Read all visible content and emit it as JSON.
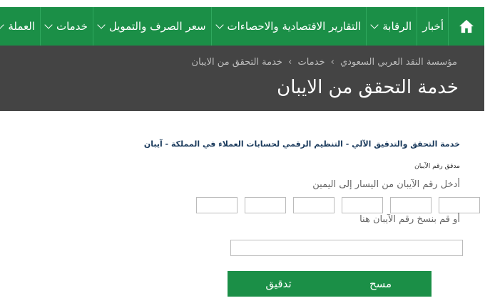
{
  "nav": {
    "items": [
      {
        "label": "أخبار",
        "has_dropdown": false
      },
      {
        "label": "الرقابة",
        "has_dropdown": true
      },
      {
        "label": "التقارير الاقتصادية والاحصاءات",
        "has_dropdown": true
      },
      {
        "label": "سعر الصرف والتمويل",
        "has_dropdown": true
      },
      {
        "label": "خدمات",
        "has_dropdown": true
      },
      {
        "label": "العملة",
        "has_dropdown": true
      }
    ],
    "home_icon": "home-icon",
    "accent_color": "#1b8f47"
  },
  "banner": {
    "breadcrumb": [
      "مؤسسة النقد العربي السعودي",
      "خدمات",
      "خدمة التحقق من الايبان"
    ],
    "title": "خدمة التحقق من الايبان",
    "background_color": "#444444"
  },
  "content": {
    "service_heading": "خدمة التحقق والتدقيق الآلي - التنظيم الرقمي لحسابات العملاء في المملكة - آيبان",
    "verifier_label": "مدقق رقم الآيبان",
    "instruction": "أدخل رقم الآيبان من اليسار إلى اليمين",
    "iban_box_count": 6,
    "paste_label": "أو قم بنسخ رقم الآيبان هنا",
    "paste_value": ""
  },
  "actions": {
    "verify_label": "تدقيق",
    "clear_label": "مسح"
  }
}
